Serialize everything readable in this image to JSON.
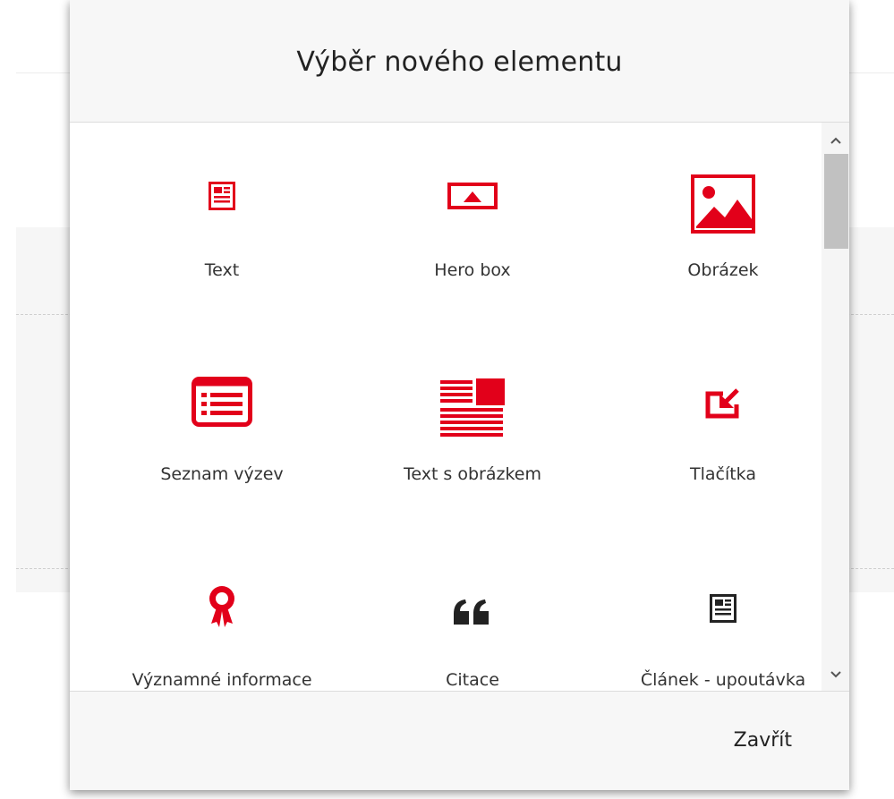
{
  "modal": {
    "title": "Výběr nového elementu",
    "close_label": "Zavřít"
  },
  "accent_color": "#e2001a",
  "elements": [
    {
      "label": "Text",
      "icon": "text-icon"
    },
    {
      "label": "Hero box",
      "icon": "hero-box-icon"
    },
    {
      "label": "Obrázek",
      "icon": "image-icon"
    },
    {
      "label": "Seznam výzev",
      "icon": "list-icon"
    },
    {
      "label": "Text s obrázkem",
      "icon": "text-with-image-icon"
    },
    {
      "label": "Tlačítka",
      "icon": "button-icon"
    },
    {
      "label": "Významné informace",
      "icon": "award-icon"
    },
    {
      "label": "Citace",
      "icon": "quote-icon"
    },
    {
      "label": "Článek - upoutávka",
      "icon": "article-teaser-icon"
    }
  ]
}
